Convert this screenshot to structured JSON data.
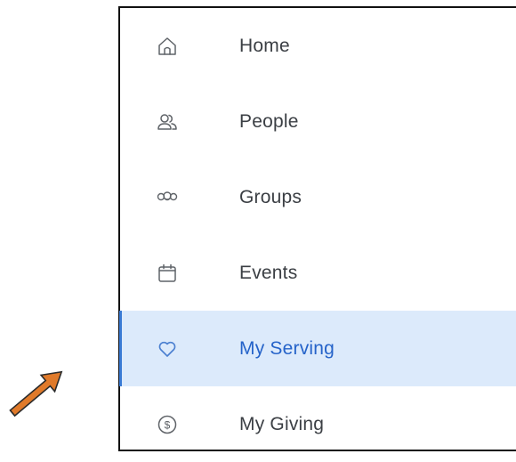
{
  "nav": {
    "items": [
      {
        "label": "Home",
        "icon": "home-icon",
        "active": false
      },
      {
        "label": "People",
        "icon": "people-icon",
        "active": false
      },
      {
        "label": "Groups",
        "icon": "groups-icon",
        "active": false
      },
      {
        "label": "Events",
        "icon": "calendar-icon",
        "active": false
      },
      {
        "label": "My Serving",
        "icon": "heart-icon",
        "active": true
      },
      {
        "label": "My Giving",
        "icon": "dollar-circle-icon",
        "active": false
      }
    ]
  },
  "colors": {
    "active_background": "#dceafb",
    "active_text": "#2563c9",
    "active_indicator": "#3a7bd5",
    "label_text": "#3b3f44",
    "icon_stroke": "#5f6368",
    "annotation_arrow": "#e07a2a"
  }
}
